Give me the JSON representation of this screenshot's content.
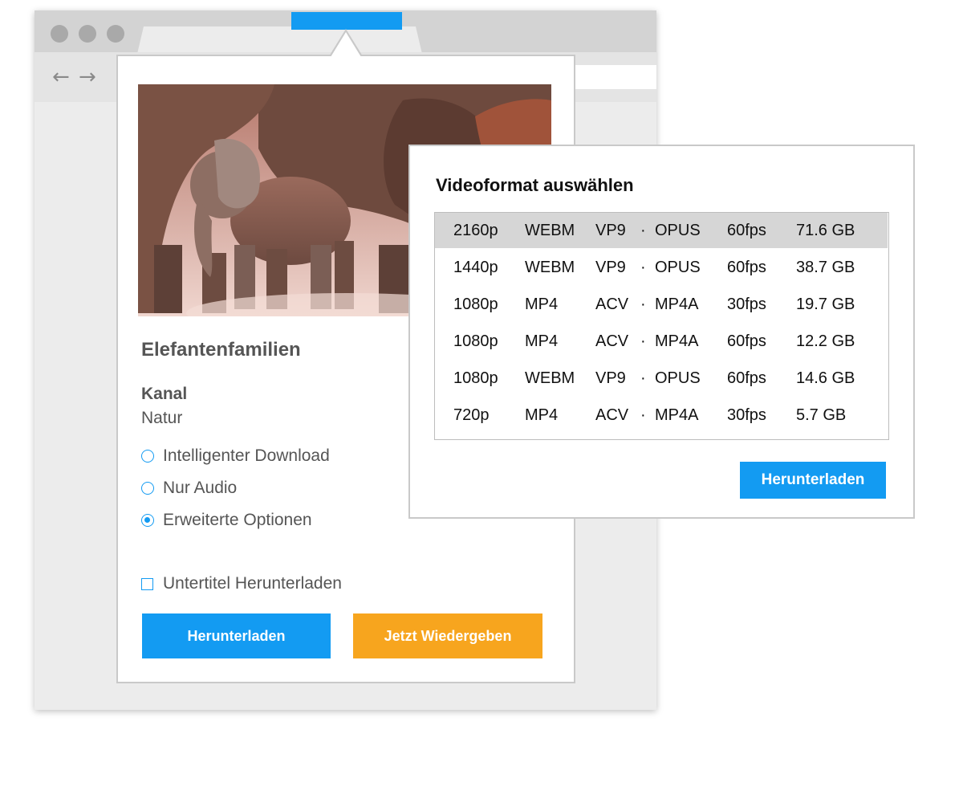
{
  "browser": {
    "window_controls": [
      "close-dot",
      "minimize-dot",
      "maximize-dot"
    ],
    "nav_back_icon": "←",
    "nav_forward_icon": "→"
  },
  "popup": {
    "video_title": "Elefantenfamilien",
    "channel_label": "Kanal",
    "channel_value": "Natur",
    "options": [
      {
        "label": "Intelligenter Download",
        "checked": false
      },
      {
        "label": "Nur Audio",
        "checked": false
      },
      {
        "label": "Erweiterte Optionen",
        "checked": true
      }
    ],
    "subtitles_label": "Untertitel Herunterladen",
    "subtitles_checked": false,
    "download_button": "Herunterladen",
    "play_button": "Jetzt Wiedergeben"
  },
  "format_dialog": {
    "title": "Videoformat auswählen",
    "formats": [
      {
        "res": "2160p",
        "container": "WEBM",
        "vcodec": "VP9",
        "sep": "·",
        "acodec": "OPUS",
        "fps": "60fps",
        "size": "71.6 GB",
        "selected": true
      },
      {
        "res": "1440p",
        "container": "WEBM",
        "vcodec": "VP9",
        "sep": "·",
        "acodec": "OPUS",
        "fps": "60fps",
        "size": "38.7 GB",
        "selected": false
      },
      {
        "res": "1080p",
        "container": "MP4",
        "vcodec": "ACV",
        "sep": "·",
        "acodec": "MP4A",
        "fps": "30fps",
        "size": "19.7 GB",
        "selected": false
      },
      {
        "res": "1080p",
        "container": "MP4",
        "vcodec": "ACV",
        "sep": "·",
        "acodec": "MP4A",
        "fps": "60fps",
        "size": "12.2 GB",
        "selected": false
      },
      {
        "res": "1080p",
        "container": "WEBM",
        "vcodec": "VP9",
        "sep": "·",
        "acodec": "OPUS",
        "fps": "60fps",
        "size": "14.6 GB",
        "selected": false
      },
      {
        "res": "720p",
        "container": "MP4",
        "vcodec": "ACV",
        "sep": "·",
        "acodec": "MP4A",
        "fps": "30fps",
        "size": "5.7 GB",
        "selected": false
      }
    ],
    "download_button": "Herunterladen"
  },
  "colors": {
    "accent_blue": "#139bf2",
    "accent_orange": "#f7a51e",
    "selected_row": "#d6d6d6"
  }
}
